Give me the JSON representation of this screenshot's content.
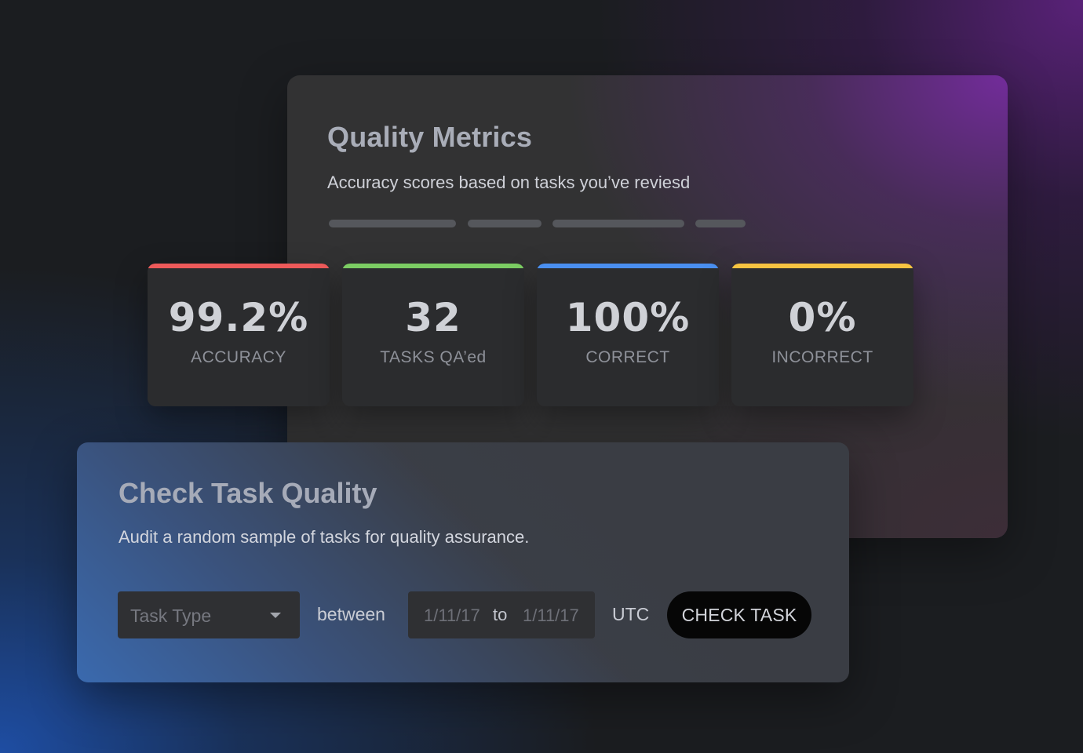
{
  "metrics": {
    "title": "Quality Metrics",
    "subtitle": "Accuracy scores based on tasks you’ve reviesd"
  },
  "stats": [
    {
      "value": "99.2%",
      "label": "ACCURACY",
      "accent": "#ee5a5a"
    },
    {
      "value": "32",
      "label": "TASKS QA’ed",
      "accent": "#7ccd63"
    },
    {
      "value": "100%",
      "label": "CORRECT",
      "accent": "#4a8ff0"
    },
    {
      "value": "0%",
      "label": "INCORRECT",
      "accent": "#f7c341"
    }
  ],
  "check": {
    "title": "Check Task Quality",
    "subtitle": "Audit a random sample of tasks for quality assurance.",
    "task_type_placeholder": "Task Type",
    "between_label": "between",
    "date_start": "1/11/17",
    "date_to": "to",
    "date_end": "1/11/17",
    "timezone": "UTC",
    "button_label": "CHECK TASK"
  },
  "icons": {
    "dropdown": "caret-down-icon"
  }
}
